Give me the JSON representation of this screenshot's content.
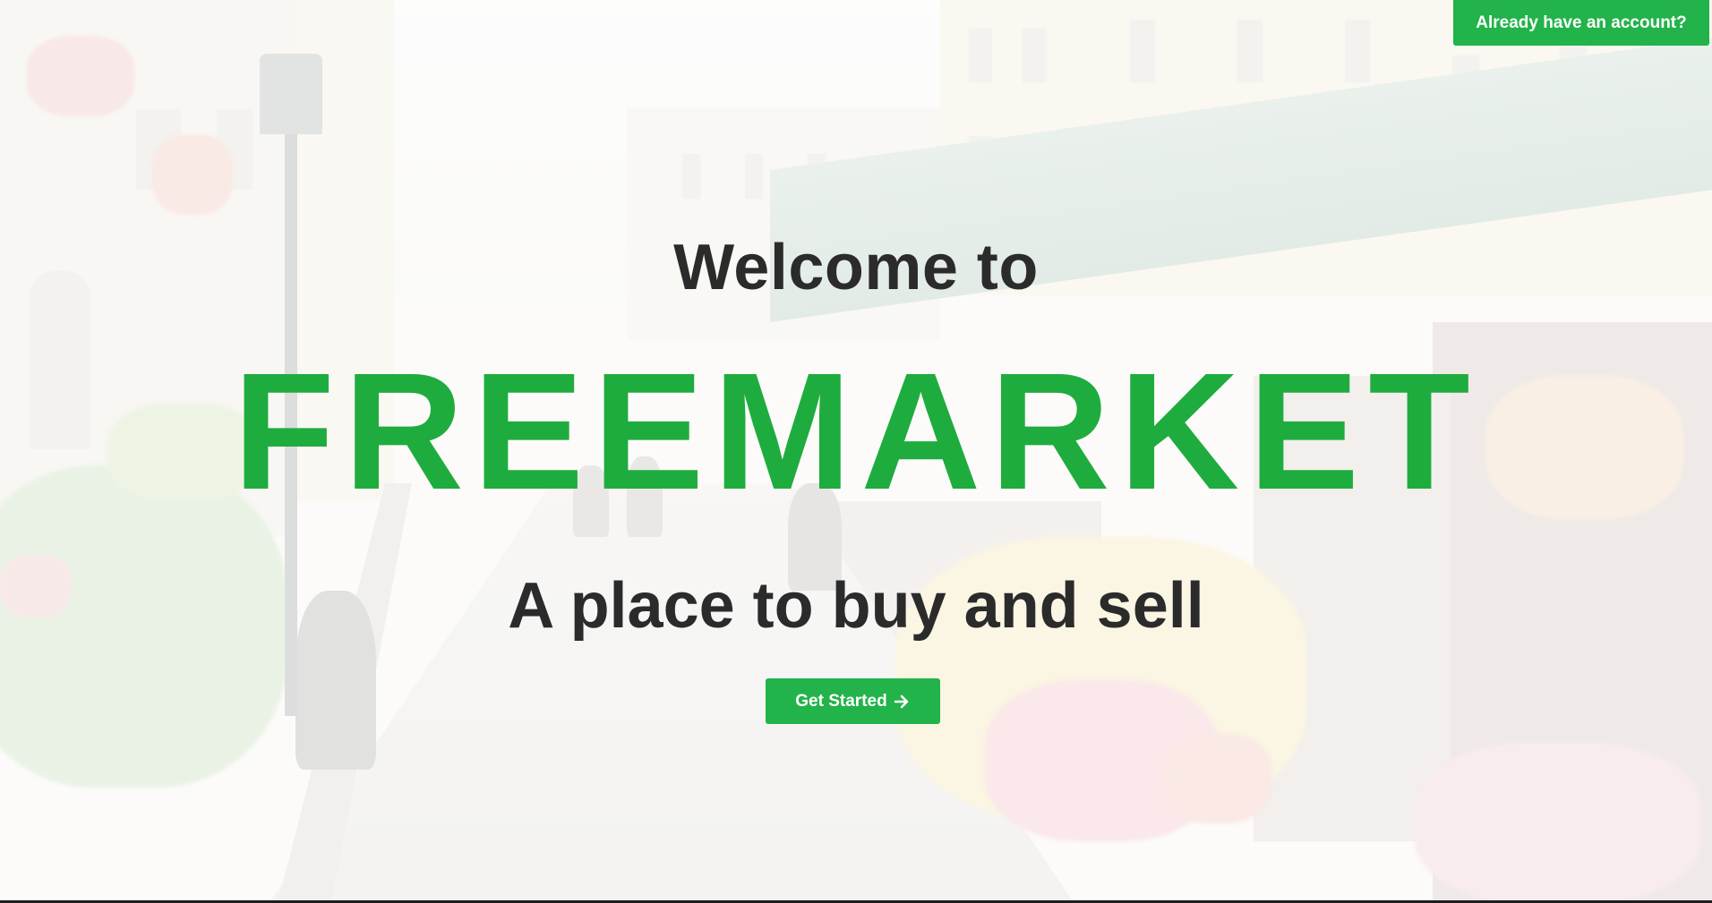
{
  "header": {
    "signin_label": "Already have an account?"
  },
  "hero": {
    "welcome": "Welcome to",
    "brand": "FREEMARKET",
    "tagline": "A place to buy and sell",
    "cta_label": "Get Started",
    "cta_icon": "arrow-right-icon"
  },
  "colors": {
    "brand_green": "#1fac3e",
    "button_green": "#22b34a",
    "heading_dark": "#2b2b2b"
  }
}
